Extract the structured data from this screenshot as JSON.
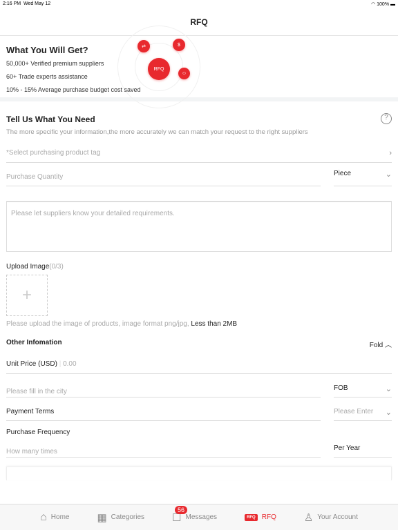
{
  "status": {
    "time": "2:16 PM",
    "date": "Wed May 12",
    "battery": "100%"
  },
  "nav": {
    "title": "RFQ"
  },
  "banner": {
    "title": "What You Will Get?",
    "benefits": [
      "50,000+ Verified premium suppliers",
      "60+ Trade experts assistance",
      "10% - 15% Average purchase budget cost saved"
    ],
    "center_icon_label": "RFQ"
  },
  "form": {
    "title": "Tell Us What You Need",
    "subtitle": "The more specific your information,the more accurately we can match your request to the right suppliers",
    "product_tag_placeholder": "*Select purchasing product tag",
    "quantity_placeholder": "Purchase Quantity",
    "unit": "Piece",
    "requirements_placeholder": "Please let suppliers know your detailed requirements.",
    "upload_label": "Upload Image",
    "upload_count": "(0/3)",
    "upload_hint": "Please upload the image of products, image format png/jpg,",
    "upload_limit": "Less than 2MB"
  },
  "other": {
    "title": "Other Infomation",
    "fold": "Fold",
    "unit_price_label": "Unit Price (USD)",
    "unit_price_placeholder": "0.00",
    "city_placeholder": "Please fill in the city",
    "trade_term": "FOB",
    "payment_label": "Payment Terms",
    "payment_placeholder": "Please Enter",
    "frequency_label": "Purchase Frequency",
    "frequency_placeholder": "How many times",
    "frequency_unit": "Per Year"
  },
  "tabs": [
    {
      "label": "Home"
    },
    {
      "label": "Categories"
    },
    {
      "label": "Messages",
      "badge": "56"
    },
    {
      "label": "RFQ",
      "icon_text": "RFQ"
    },
    {
      "label": "Your Account"
    }
  ],
  "colors": {
    "accent": "#e8292e"
  }
}
